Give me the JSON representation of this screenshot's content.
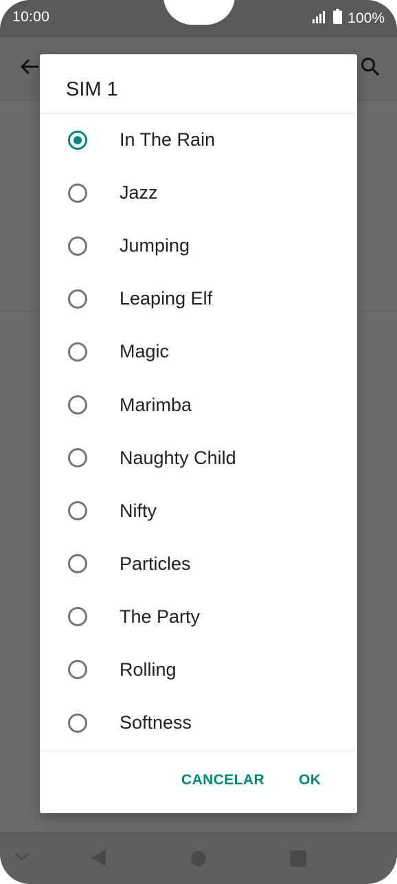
{
  "status_bar": {
    "time": "10:00",
    "battery": "100%",
    "icons": [
      "signal-icon",
      "battery-icon"
    ]
  },
  "background_app": {
    "icons": [
      "back-arrow-icon",
      "search-icon"
    ]
  },
  "dialog": {
    "title": "SIM 1",
    "selected": "In The Rain",
    "accent_color": "#00897b",
    "options": [
      {
        "label": "In The Rain",
        "checked": true
      },
      {
        "label": "Jazz",
        "checked": false
      },
      {
        "label": "Jumping",
        "checked": false
      },
      {
        "label": "Leaping Elf",
        "checked": false
      },
      {
        "label": "Magic",
        "checked": false
      },
      {
        "label": "Marimba",
        "checked": false
      },
      {
        "label": "Naughty Child",
        "checked": false
      },
      {
        "label": "Nifty",
        "checked": false
      },
      {
        "label": "Particles",
        "checked": false
      },
      {
        "label": "The Party",
        "checked": false
      },
      {
        "label": "Rolling",
        "checked": false
      },
      {
        "label": "Softness",
        "checked": false
      }
    ],
    "cancel_label": "CANCELAR",
    "ok_label": "OK"
  },
  "nav_bar": {
    "icons": [
      "chevron-down-icon",
      "nav-back-icon",
      "nav-home-icon",
      "nav-recents-icon"
    ]
  }
}
